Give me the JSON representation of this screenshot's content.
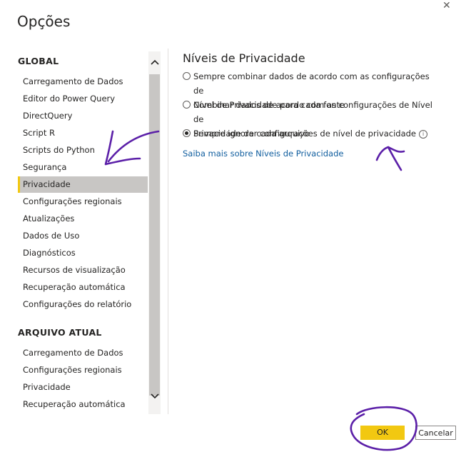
{
  "dialog": {
    "title": "Opções",
    "close_glyph": "✕"
  },
  "sidebar": {
    "global_header": "GLOBAL",
    "global_items": [
      {
        "label": "Carregamento de Dados"
      },
      {
        "label": "Editor do Power Query"
      },
      {
        "label": "DirectQuery"
      },
      {
        "label": "Script R"
      },
      {
        "label": "Scripts do Python"
      },
      {
        "label": "Segurança"
      },
      {
        "label": "Privacidade",
        "active": true
      },
      {
        "label": "Configurações regionais"
      },
      {
        "label": "Atualizações"
      },
      {
        "label": "Dados de Uso"
      },
      {
        "label": "Diagnósticos"
      },
      {
        "label": "Recursos de visualização"
      },
      {
        "label": "Recuperação automática"
      },
      {
        "label": "Configurações do relatório"
      }
    ],
    "current_file_header": "ARQUIVO ATUAL",
    "current_file_items": [
      {
        "label": "Carregamento de Dados"
      },
      {
        "label": "Configurações regionais"
      },
      {
        "label": "Privacidade"
      },
      {
        "label": "Recuperação automática"
      }
    ]
  },
  "scrollbar": {
    "up_icon": "chevron-up-icon",
    "down_icon": "chevron-down-icon"
  },
  "panel": {
    "title": "Níveis de Privacidade",
    "options": [
      {
        "line1": "Sempre combinar dados de acordo com as configurações de",
        "line2": "Nível de Privacidade para cada fonte",
        "selected": false
      },
      {
        "line1": "Combinar dados de acordo com as configurações de Nível de",
        "line2": "Privacidade de cada arquivo",
        "selected": false
      },
      {
        "line1": "Sempre ignorar configurações de nível de privacidade",
        "line2": "",
        "selected": true
      }
    ],
    "info_glyph": "i",
    "learn_more_link": "Saiba mais sobre Níveis de Privacidade"
  },
  "footer": {
    "ok_label": "OK",
    "cancel_label": "Cancelar"
  },
  "colors": {
    "accent_yellow": "#f2c811",
    "link_blue": "#0f5d9e",
    "active_item_bg": "#c8c6c4",
    "annotation_purple": "#5b1fa8"
  }
}
